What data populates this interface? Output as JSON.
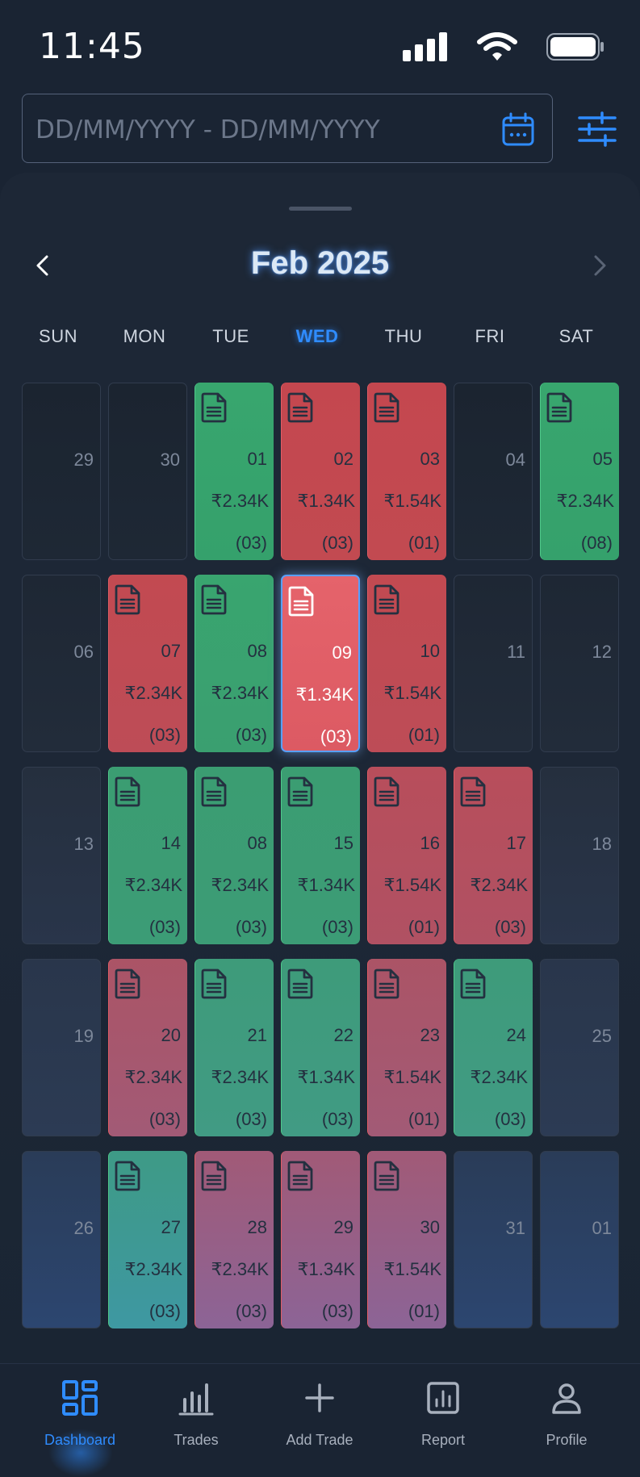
{
  "status": {
    "time": "11:45"
  },
  "date_filter": {
    "placeholder": "DD/MM/YYYY - DD/MM/YYYY"
  },
  "calendar": {
    "month_title": "Feb 2025",
    "weekdays": [
      "SUN",
      "MON",
      "TUE",
      "WED",
      "THU",
      "FRI",
      "SAT"
    ],
    "active_weekday": "WED",
    "weeks": [
      [
        {
          "day": "29"
        },
        {
          "day": "30"
        },
        {
          "day": "01",
          "amount": "₹2.34K",
          "count": "(03)",
          "result": "profit"
        },
        {
          "day": "02",
          "amount": "₹1.34K",
          "count": "(03)",
          "result": "loss"
        },
        {
          "day": "03",
          "amount": "₹1.54K",
          "count": "(01)",
          "result": "loss"
        },
        {
          "day": "04"
        },
        {
          "day": "05",
          "amount": "₹2.34K",
          "count": "(08)",
          "result": "profit"
        }
      ],
      [
        {
          "day": "06"
        },
        {
          "day": "07",
          "amount": "₹2.34K",
          "count": "(03)",
          "result": "loss"
        },
        {
          "day": "08",
          "amount": "₹2.34K",
          "count": "(03)",
          "result": "profit"
        },
        {
          "day": "09",
          "amount": "₹1.34K",
          "count": "(03)",
          "result": "loss",
          "selected": true
        },
        {
          "day": "10",
          "amount": "₹1.54K",
          "count": "(01)",
          "result": "loss"
        },
        {
          "day": "11"
        },
        {
          "day": "12"
        }
      ],
      [
        {
          "day": "13"
        },
        {
          "day": "14",
          "amount": "₹2.34K",
          "count": "(03)",
          "result": "profit"
        },
        {
          "day": "08",
          "amount": "₹2.34K",
          "count": "(03)",
          "result": "profit"
        },
        {
          "day": "15",
          "amount": "₹1.34K",
          "count": "(03)",
          "result": "profit"
        },
        {
          "day": "16",
          "amount": "₹1.54K",
          "count": "(01)",
          "result": "loss"
        },
        {
          "day": "17",
          "amount": "₹2.34K",
          "count": "(03)",
          "result": "loss"
        },
        {
          "day": "18"
        }
      ],
      [
        {
          "day": "19"
        },
        {
          "day": "20",
          "amount": "₹2.34K",
          "count": "(03)",
          "result": "loss"
        },
        {
          "day": "21",
          "amount": "₹2.34K",
          "count": "(03)",
          "result": "profit"
        },
        {
          "day": "22",
          "amount": "₹1.34K",
          "count": "(03)",
          "result": "profit"
        },
        {
          "day": "23",
          "amount": "₹1.54K",
          "count": "(01)",
          "result": "loss"
        },
        {
          "day": "24",
          "amount": "₹2.34K",
          "count": "(03)",
          "result": "profit"
        },
        {
          "day": "25"
        }
      ],
      [
        {
          "day": "26"
        },
        {
          "day": "27",
          "amount": "₹2.34K",
          "count": "(03)",
          "result": "profit"
        },
        {
          "day": "28",
          "amount": "₹2.34K",
          "count": "(03)",
          "result": "loss"
        },
        {
          "day": "29",
          "amount": "₹1.34K",
          "count": "(03)",
          "result": "loss"
        },
        {
          "day": "30",
          "amount": "₹1.54K",
          "count": "(01)",
          "result": "loss"
        },
        {
          "day": "31"
        },
        {
          "day": "01"
        }
      ]
    ]
  },
  "bottom_nav": {
    "active": "Dashboard",
    "tabs": [
      {
        "label": "Dashboard",
        "icon": "dashboard-icon"
      },
      {
        "label": "Trades",
        "icon": "bar-chart-icon"
      },
      {
        "label": "Add Trade",
        "icon": "plus-icon"
      },
      {
        "label": "Report",
        "icon": "report-icon"
      },
      {
        "label": "Profile",
        "icon": "profile-icon"
      }
    ]
  },
  "colors": {
    "accent": "#2f8cff",
    "profit": "#33a36e",
    "loss": "#c0484e",
    "selected": "#e05a62"
  }
}
